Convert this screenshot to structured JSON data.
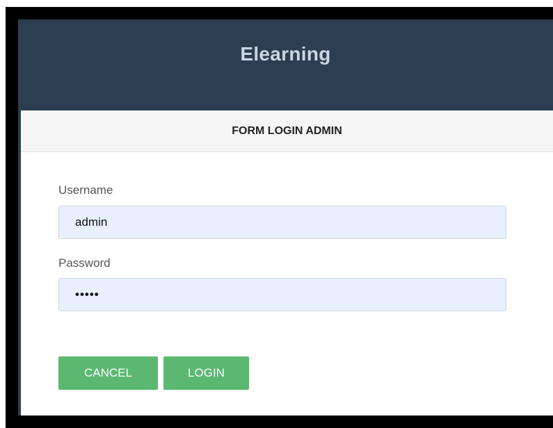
{
  "app": {
    "title": "Elearning"
  },
  "panel": {
    "heading": "FORM LOGIN ADMIN"
  },
  "form": {
    "username": {
      "label": "Username",
      "value": "admin"
    },
    "password": {
      "label": "Password",
      "value": "•••••"
    },
    "cancel_label": "CANCEL",
    "login_label": "LOGIN"
  },
  "colors": {
    "header_bg": "#2c3e50",
    "button_bg": "#5cb870",
    "input_bg": "#e8f0fe"
  }
}
